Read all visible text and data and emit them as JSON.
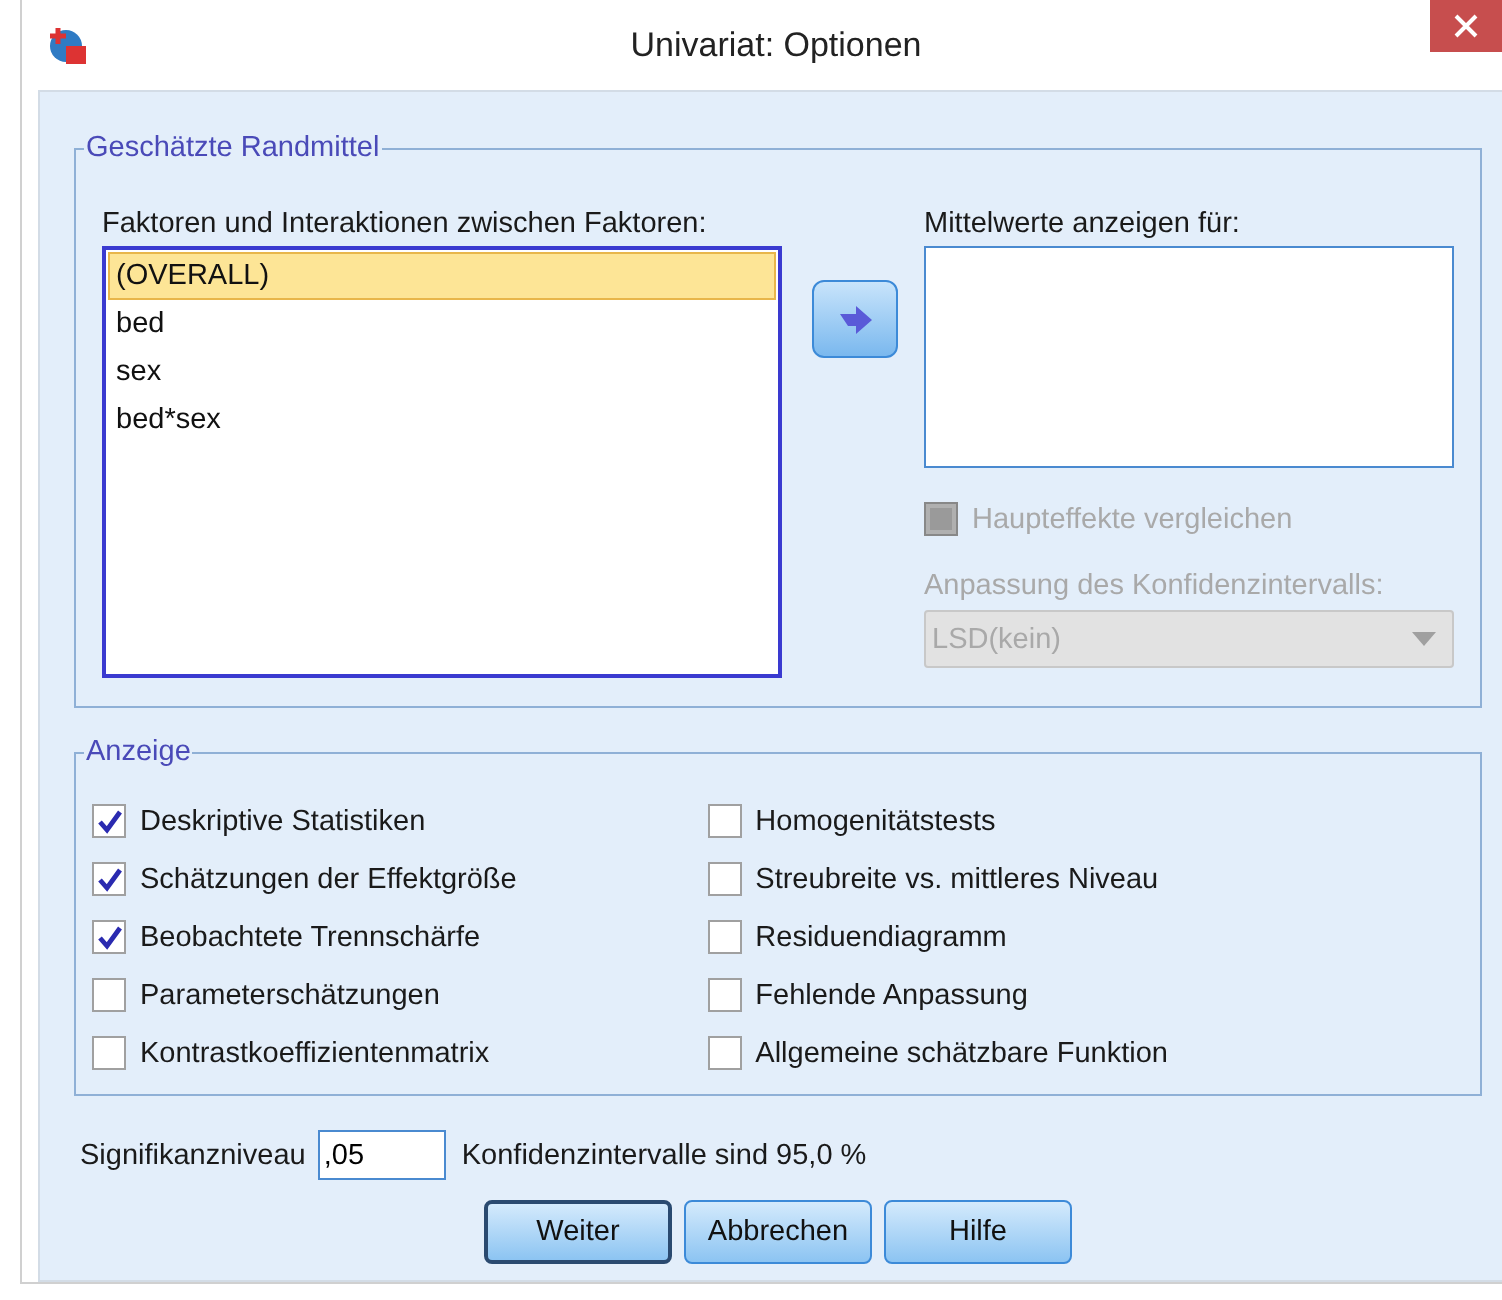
{
  "window": {
    "title": "Univariat: Optionen"
  },
  "estimated_means": {
    "title": "Geschätzte Randmittel",
    "factors_label": "Faktoren und Interaktionen zwischen Faktoren:",
    "factors": [
      {
        "label": "(OVERALL)",
        "selected": true
      },
      {
        "label": "bed",
        "selected": false
      },
      {
        "label": "sex",
        "selected": false
      },
      {
        "label": "bed*sex",
        "selected": false
      }
    ],
    "display_means_label": "Mittelwerte anzeigen für:",
    "compare_main_effects": {
      "label": "Haupteffekte vergleichen",
      "checked": false,
      "disabled": true
    },
    "ci_adjustment": {
      "label": "Anpassung des Konfidenzintervalls:",
      "value": "LSD(kein)",
      "disabled": true
    }
  },
  "display": {
    "title": "Anzeige",
    "columns": [
      [
        {
          "label": "Deskriptive Statistiken",
          "checked": true
        },
        {
          "label": "Schätzungen der Effektgröße",
          "checked": true
        },
        {
          "label": "Beobachtete Trennschärfe",
          "checked": true
        },
        {
          "label": "Parameterschätzungen",
          "checked": false
        },
        {
          "label": "Kontrastkoeffizientenmatrix",
          "checked": false
        }
      ],
      [
        {
          "label": "Homogenitätstests",
          "checked": false
        },
        {
          "label": "Streubreite vs. mittleres Niveau",
          "checked": false
        },
        {
          "label": "Residuendiagramm",
          "checked": false
        },
        {
          "label": "Fehlende Anpassung",
          "checked": false
        },
        {
          "label": "Allgemeine schätzbare Funktion",
          "checked": false
        }
      ]
    ]
  },
  "significance": {
    "label": "Signifikanzniveau",
    "value": ",05",
    "note": "Konfidenzintervalle sind 95,0 %"
  },
  "buttons": [
    {
      "label": "Weiter",
      "default": true
    },
    {
      "label": "Abbrechen",
      "default": false
    },
    {
      "label": "Hilfe",
      "default": false
    }
  ]
}
